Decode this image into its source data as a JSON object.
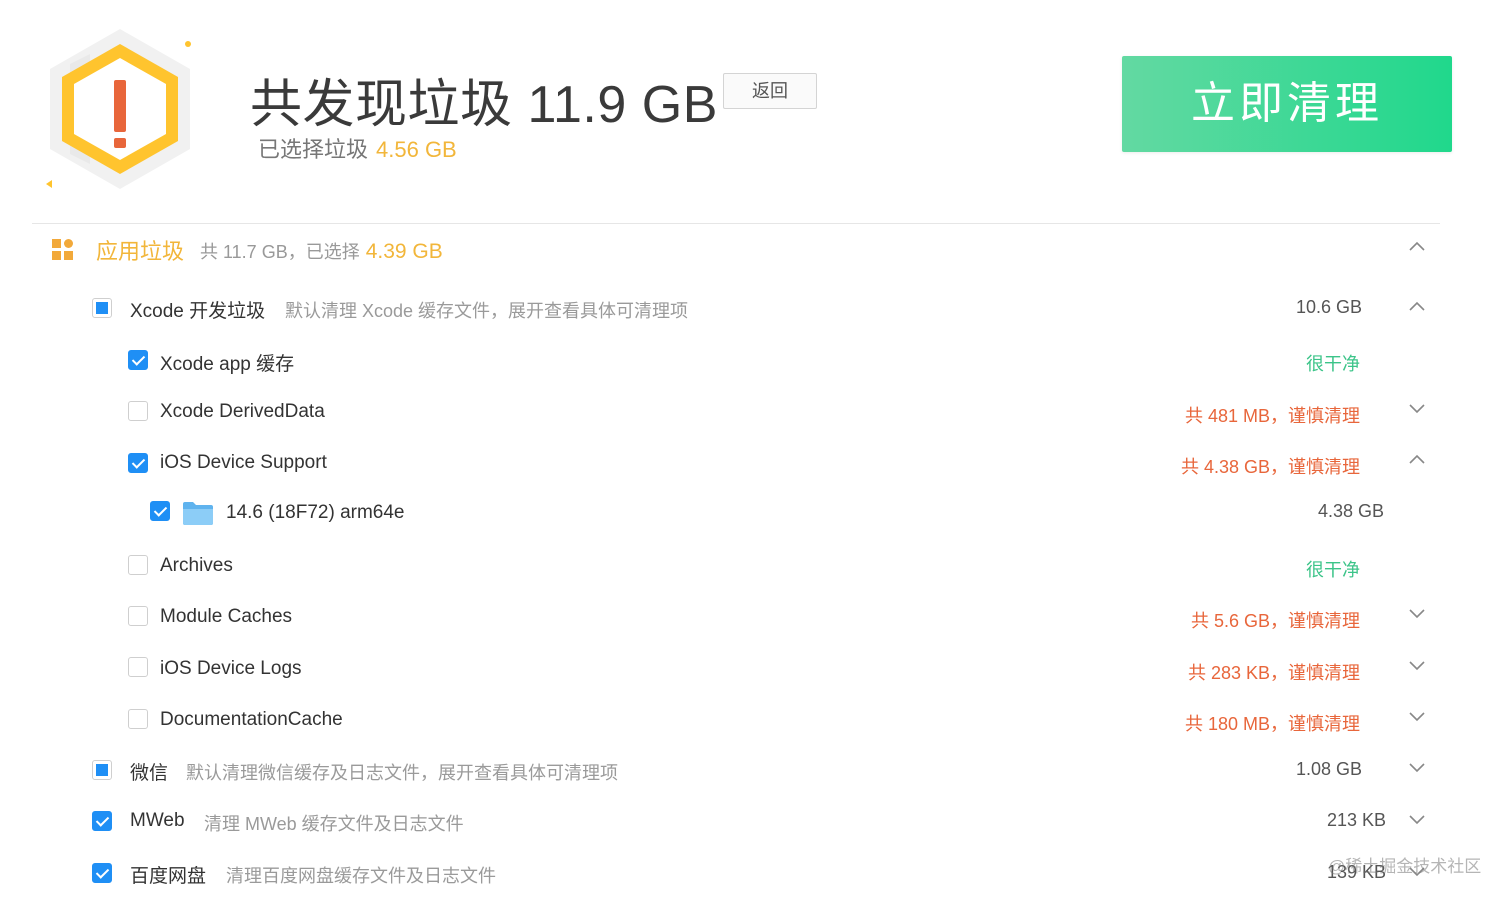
{
  "header": {
    "title": "共发现垃圾 11.9 GB",
    "back_label": "返回",
    "selected_prefix": "已选择垃圾",
    "selected_value": "4.56 GB",
    "clean_button": "立即清理"
  },
  "section": {
    "title": "应用垃圾",
    "summary_prefix": "共 11.7 GB，已选择",
    "summary_value": "4.39 GB"
  },
  "rows": [
    {
      "label": "Xcode 开发垃圾",
      "description": "默认清理 Xcode 缓存文件，展开查看具体可清理项",
      "size": "10.6 GB",
      "check": "partial",
      "chevron": "up"
    },
    {
      "label": "Xcode app 缓存",
      "status": "很干净",
      "check": "checked"
    },
    {
      "label": "Xcode DerivedData",
      "status": "共 481 MB，谨慎清理",
      "check": "empty",
      "chevron": "down"
    },
    {
      "label": "iOS Device Support",
      "status": "共 4.38 GB，谨慎清理",
      "check": "checked",
      "chevron": "up"
    },
    {
      "label": "14.6 (18F72) arm64e",
      "size": "4.38 GB",
      "check": "checked",
      "icon": "folder-icon"
    },
    {
      "label": "Archives",
      "status": "很干净",
      "check": "empty"
    },
    {
      "label": "Module Caches",
      "status": "共 5.6 GB，谨慎清理",
      "check": "empty",
      "chevron": "down"
    },
    {
      "label": "iOS Device Logs",
      "status": "共 283 KB，谨慎清理",
      "check": "empty",
      "chevron": "down"
    },
    {
      "label": "DocumentationCache",
      "status": "共 180 MB，谨慎清理",
      "check": "empty",
      "chevron": "down"
    },
    {
      "label": "微信",
      "description": "默认清理微信缓存及日志文件，展开查看具体可清理项",
      "size": "1.08 GB",
      "check": "partial",
      "chevron": "down"
    },
    {
      "label": "MWeb",
      "description": "清理 MWeb 缓存文件及日志文件",
      "size": "213 KB",
      "check": "checked",
      "chevron": "down"
    },
    {
      "label": "百度网盘",
      "description": "清理百度网盘缓存文件及日志文件",
      "size": "139 KB",
      "check": "checked",
      "chevron": "down"
    }
  ],
  "watermark": "@稀土掘金技术社区",
  "colors": {
    "accent_yellow": "#f2b63a",
    "warn_orange": "#e8663b",
    "ok_green": "#3cc489",
    "check_blue": "#1f8ff5",
    "button_green": "#20d88c"
  }
}
